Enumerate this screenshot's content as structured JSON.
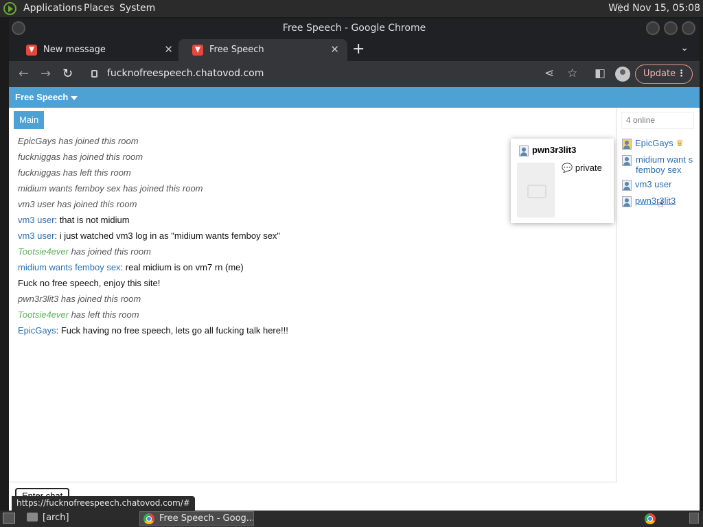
{
  "system_panel": {
    "menus": [
      "Applications",
      "Places",
      "System"
    ],
    "clock": "Wed Nov 15, 05:08"
  },
  "window": {
    "title": "Free Speech - Google Chrome"
  },
  "tabs": [
    {
      "title": "New message",
      "active": false
    },
    {
      "title": "Free Speech",
      "active": true
    }
  ],
  "toolbar": {
    "url": "fucknofreespeech.chatovod.com",
    "update_label": "Update"
  },
  "room": {
    "name": "Free Speech",
    "tab_main": "Main",
    "enter_chat": "Enter chat"
  },
  "messages": [
    {
      "type": "sys",
      "text": "EpicGays has joined this room"
    },
    {
      "type": "sys",
      "text": "fuckniggas has joined this room"
    },
    {
      "type": "sys",
      "text": "fuckniggas has left this room"
    },
    {
      "type": "sys",
      "text": "midium wants femboy sex has joined this room"
    },
    {
      "type": "sys",
      "text": "vm3 user has joined this room"
    },
    {
      "type": "chat",
      "nick": "vm3 user",
      "text": ": that is not midium"
    },
    {
      "type": "chat",
      "nick": "vm3 user",
      "text": ": i just watched vm3 log in as \"midium wants femboy sex\""
    },
    {
      "type": "sys-green",
      "nick": "Tootsie4ever",
      "text": " has joined this room"
    },
    {
      "type": "chat",
      "nick": "midium wants femboy sex",
      "text": ": real midium is on vm7 rn (me)"
    },
    {
      "type": "plain",
      "text": "Fuck no free speech, enjoy this site!"
    },
    {
      "type": "sys",
      "text": "pwn3r3lit3 has joined this room"
    },
    {
      "type": "sys-green",
      "nick": "Tootsie4ever",
      "text": " has left this room"
    },
    {
      "type": "chat",
      "nick": "EpicGays",
      "text": ": Fuck having no free speech, lets go all fucking talk here!!!"
    }
  ],
  "userlist": {
    "online": "4 online",
    "users": [
      {
        "name": "EpicGays",
        "crown": true
      },
      {
        "name": "midium want s femboy sex",
        "crown": false
      },
      {
        "name": "vm3 user",
        "crown": false
      },
      {
        "name": "pwn3r3lit3",
        "crown": false
      }
    ]
  },
  "popup": {
    "name": "pwn3r3lit3",
    "private_label": "private"
  },
  "status_url": "https://fucknofreespeech.chatovod.com/#",
  "taskbar": {
    "arch": "[arch]",
    "chrome_task": "Free Speech - Goog..."
  }
}
